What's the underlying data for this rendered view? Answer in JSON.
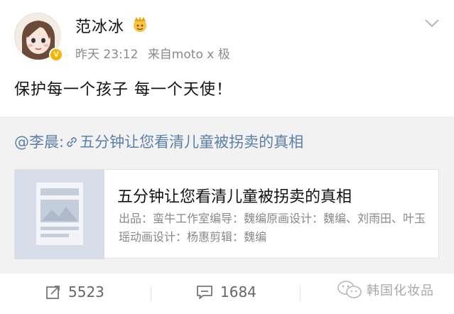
{
  "post": {
    "author": "范冰冰",
    "verified_badge": "V",
    "time": "昨天 23:12",
    "source": "来自moto x 极",
    "text": "保护每一个孩子 每一个天使！"
  },
  "repost": {
    "mention": "@李晨:",
    "link_text": "五分钟让您看清儿童被拐卖的真相",
    "card": {
      "title": "五分钟让您看清儿童被拐卖的真相",
      "description": "出品：蛮牛工作室编导：魏编原画设计：魏编、刘雨田、叶玉瑶动画设计：杨惠剪辑：魏编"
    }
  },
  "actions": {
    "repost_count": "5523",
    "comment_count": "1684"
  },
  "watermark": {
    "text": "韩国化妆品"
  },
  "icons": {
    "crown": "crown-emoji-icon",
    "chevron": "chevron-down-icon",
    "link": "link-icon",
    "repost": "repost-icon",
    "comment": "comment-icon",
    "wechat": "wechat-icon"
  },
  "colors": {
    "link": "#5b7fa8",
    "muted": "#8a8a8a",
    "badge": "#f5b400",
    "repost_bg": "#f2f2f2"
  }
}
